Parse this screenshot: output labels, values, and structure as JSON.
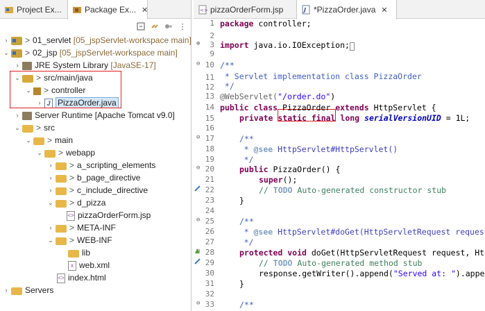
{
  "left_tabs": [
    {
      "label": "Project Ex...",
      "close": ""
    },
    {
      "label": "Package Ex...",
      "close": "✕"
    }
  ],
  "tree": [
    {
      "label": "01_servlet",
      "suffix": "[05_jspServlet-workspace main]"
    },
    {
      "label": "02_jsp",
      "suffix": "[05_jspServlet-workspace main]"
    },
    {
      "label": "JRE System Library",
      "suffix": "[JavaSE-17]"
    },
    {
      "label": "src/main/java"
    },
    {
      "label": "controller"
    },
    {
      "label": "PizzaOrder.java"
    },
    {
      "label": "Server Runtime [Apache Tomcat v9.0]"
    },
    {
      "label": "src"
    },
    {
      "label": "main"
    },
    {
      "label": "webapp"
    },
    {
      "label": "a_scripting_elements"
    },
    {
      "label": "b_page_directive"
    },
    {
      "label": "c_include_directive"
    },
    {
      "label": "d_pizza"
    },
    {
      "label": "pizzaOrderForm.jsp"
    },
    {
      "label": "META-INF"
    },
    {
      "label": "WEB-INF"
    },
    {
      "label": "lib"
    },
    {
      "label": "web.xml"
    },
    {
      "label": "index.html"
    },
    {
      "label": "Servers"
    }
  ],
  "editor_tabs": [
    {
      "label": "pizzaOrderForm.jsp"
    },
    {
      "label": "*PizzaOrder.java",
      "close": "✕"
    }
  ],
  "code": {
    "l1": [
      "package",
      " controller;"
    ],
    "l3": [
      "import",
      " java.io.IOException;"
    ],
    "l10": "/**",
    "l11": " * Servlet implementation class PizzaOrder",
    "l12": " */",
    "l13": [
      "@WebServlet(",
      "\"/order.do\"",
      ")"
    ],
    "l14": [
      "public class",
      " PizzaOrder ",
      "extends",
      " HttpServlet {"
    ],
    "l15": [
      "private static final long",
      "serialVersionUID",
      " = 1L;"
    ],
    "l17": "/**",
    "l18": [
      "     * ",
      "@see",
      " HttpServlet#HttpServlet()"
    ],
    "l19": "     */",
    "l20": [
      "public",
      " PizzaOrder() {"
    ],
    "l21": [
      "super",
      "();"
    ],
    "l22": [
      "// ",
      "TODO",
      " Auto-generated constructor stub"
    ],
    "l23": "}",
    "l25": "/**",
    "l26": [
      "     * ",
      "@see",
      " HttpServlet#doGet(HttpServletRequest request"
    ],
    "l27": "     */",
    "l28": [
      "protected void",
      " doGet(HttpServletRequest request, Ht"
    ],
    "l29": [
      "// ",
      "TODO",
      " Auto-generated method stub"
    ],
    "l30": [
      "response.getWriter().append(",
      "\"Served at: \"",
      ").appe"
    ],
    "l31": "}",
    "l33": "/**"
  },
  "line_numbers": [
    "1",
    "2",
    "3",
    "9",
    "10",
    "11",
    "12",
    "13",
    "14",
    "15",
    "16",
    "17",
    "18",
    "19",
    "20",
    "21",
    "22",
    "23",
    "24",
    "25",
    "26",
    "27",
    "28",
    "29",
    "30",
    "31",
    "32",
    "33"
  ]
}
